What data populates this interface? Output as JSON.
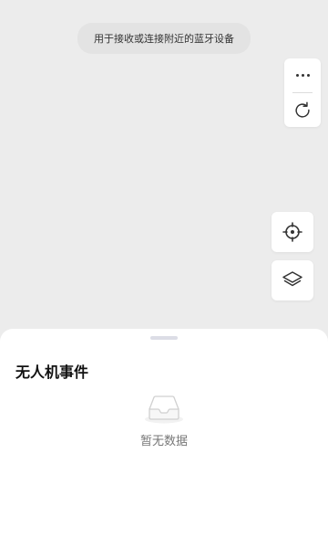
{
  "toast": {
    "text": "用于接收或连接附近的蓝牙设备"
  },
  "map_controls": {
    "more_icon": "more-horizontal-icon",
    "refresh_icon": "refresh-icon",
    "locate_icon": "crosshair-icon",
    "layers_icon": "layers-icon"
  },
  "events_panel": {
    "title": "无人机事件",
    "empty_icon": "empty-inbox-icon",
    "empty_text": "暂无数据"
  },
  "colors": {
    "map_background": "#ececec",
    "panel_background": "#ffffff",
    "handle": "#dcdde6",
    "title_text": "#111111",
    "empty_text": "#777777"
  }
}
